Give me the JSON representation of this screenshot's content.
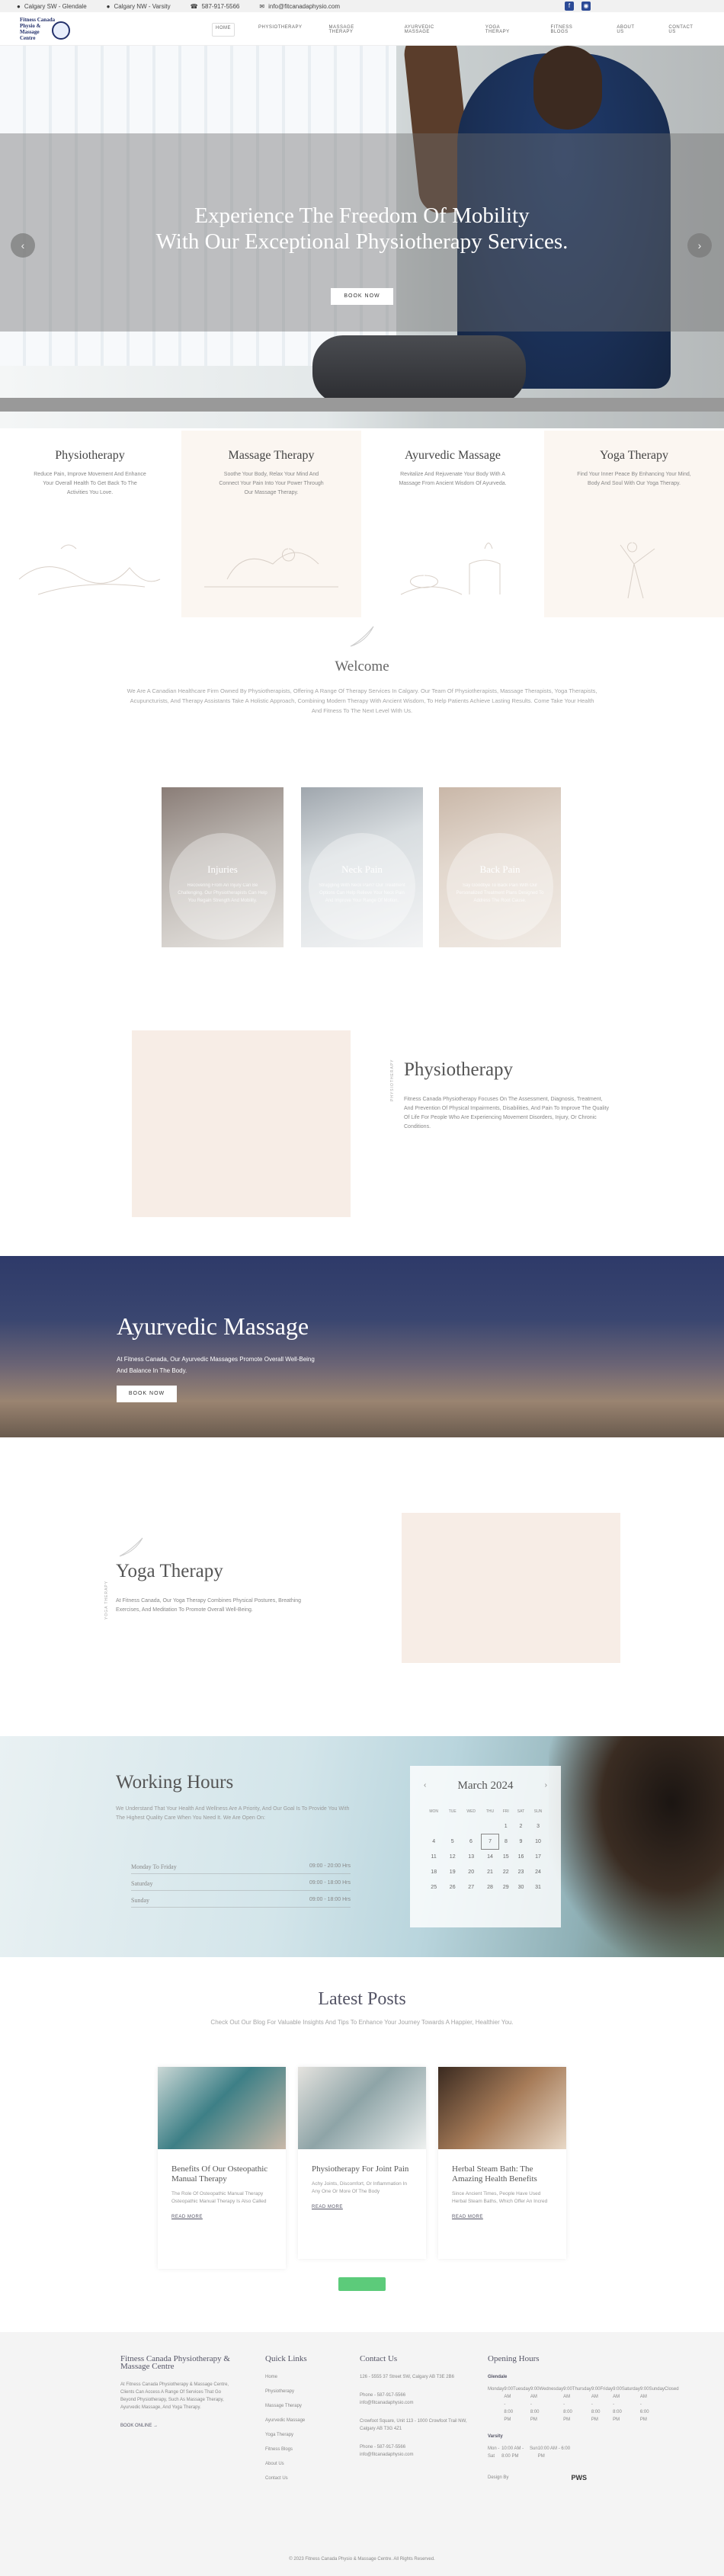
{
  "topbar": {
    "locations": [
      "Calgary SW - Glendale",
      "Calgary NW - Varsity"
    ],
    "phone": "587-917-5566",
    "email": "info@fitcanadaphysio.com"
  },
  "logo": {
    "line1": "Fitness Canada",
    "line2": "Physio &",
    "line3": "Massage",
    "line4": "Centre"
  },
  "menu": [
    "HOME",
    "PHYSIOTHERAPY",
    "MASSAGE THERAPY",
    "AYURVEDIC MASSAGE",
    "YOGA THERAPY",
    "FITNESS BLOGS",
    "ABOUT US",
    "CONTACT US"
  ],
  "hero": {
    "line1": "Experience The Freedom Of Mobility",
    "line2": "With Our Exceptional Physiotherapy Services.",
    "button": "BOOK NOW"
  },
  "services": [
    {
      "title": "Physiotherapy",
      "text": "Reduce Pain, Improve Movement And Enhance Your Overall Health To Get Back To The Activities You Love."
    },
    {
      "title": "Massage Therapy",
      "text": "Soothe Your Body, Relax Your Mind And Connect Your Pain Into Your Power Through Our Massage Therapy."
    },
    {
      "title": "Ayurvedic Massage",
      "text": "Revitalize And Rejuvenate Your Body With A Massage From Ancient Wisdom Of Ayurveda."
    },
    {
      "title": "Yoga Therapy",
      "text": "Find Your Inner Peace By Enhancing Your Mind, Body And Soul With Our Yoga Therapy."
    }
  ],
  "welcome": {
    "title": "Welcome",
    "text": "We Are A Canadian Healthcare Firm Owned By Physiotherapists, Offering A Range Of Therapy Services In Calgary. Our Team Of Physiotherapists, Massage Therapists, Yoga Therapists, Acupuncturists, And Therapy Assistants Take A Holistic Approach, Combining Modern Therapy With Ancient Wisdom, To Help Patients Achieve Lasting Results. Come Take Your Health And Fitness To The Next Level With Us."
  },
  "conditions": [
    {
      "title": "Injuries",
      "text": "Recovering From An Injury Can Be Challenging. Our Physiotherapists Can Help You Regain Strength And Mobility."
    },
    {
      "title": "Neck Pain",
      "text": "Struggling With Neck Pain? Our Treatment Options Can Help Relieve Your Neck Pain And Improve Your Range Of Motion."
    },
    {
      "title": "Back Pain",
      "text": "Say Goodbye To Back Pain With Our Personalized Treatment Plans Designed To Address The Root Cause."
    }
  ],
  "physio": {
    "label": "PHYSIOTHERAPY",
    "title": "Physiotherapy",
    "text": "Fitness Canada Physiotherapy Focuses On The Assessment, Diagnosis, Treatment, And Prevention Of Physical Impairments, Disabilities, And Pain To Improve The Quality Of Life For People Who Are Experiencing Movement Disorders, Injury, Or Chronic Conditions."
  },
  "ayurvedic": {
    "title": "Ayurvedic Massage",
    "text": "At Fitness Canada, Our Ayurvedic Massages Promote Overall Well-Being And Balance In The Body.",
    "button": "BOOK NOW"
  },
  "yoga": {
    "label": "YOGA THERAPY",
    "title": "Yoga Therapy",
    "text": "At Fitness Canada, Our Yoga Therapy Combines Physical Postures, Breathing Exercises, And Meditation To Promote Overall Well-Being."
  },
  "working_hours": {
    "title": "Working Hours",
    "text": "We Understand That Your Health And Wellness Are A Priority, And Our Goal Is To Provide You With The Highest Quality Care When You Need It. We Are Open On:",
    "rows": [
      {
        "day": "Monday To Friday",
        "time": "09:00 - 20:00 Hrs"
      },
      {
        "day": "Saturday",
        "time": "09:00 - 18:00 Hrs"
      },
      {
        "day": "Sunday",
        "time": "09:00 - 18:00 Hrs"
      }
    ]
  },
  "calendar": {
    "month": "March 2024",
    "days": [
      "MON",
      "TUE",
      "WED",
      "THU",
      "FRI",
      "SAT",
      "SUN"
    ],
    "weeks": [
      [
        "",
        "",
        "",
        "",
        "1",
        "2",
        "3"
      ],
      [
        "4",
        "5",
        "6",
        "7",
        "8",
        "9",
        "10"
      ],
      [
        "11",
        "12",
        "13",
        "14",
        "15",
        "16",
        "17"
      ],
      [
        "18",
        "19",
        "20",
        "21",
        "22",
        "23",
        "24"
      ],
      [
        "25",
        "26",
        "27",
        "28",
        "29",
        "30",
        "31"
      ]
    ],
    "today": "7"
  },
  "posts": {
    "title": "Latest Posts",
    "subtitle": "Check Out Our Blog For Valuable Insights And Tips To Enhance Your Journey Towards A Happier, Healthier You.",
    "items": [
      {
        "title": "Benefits Of Our Osteopathic Manual Therapy",
        "text": "The Role Of Osteopathic Manual Therapy Osteopathic Manual Therapy Is Also Called",
        "link": "READ MORE"
      },
      {
        "title": "Physiotherapy For Joint Pain",
        "text": "Achy Joints, Discomfort, Or Inflammation In Any One Or More Of The Body",
        "link": "READ MORE"
      },
      {
        "title": "Herbal Steam Bath: The Amazing Health Benefits",
        "text": "Since Ancient Times, People Have Used Herbal Steam Baths, Which Offer An Incred",
        "link": "READ MORE"
      }
    ]
  },
  "footer": {
    "about_title": "Fitness Canada Physiotherapy & Massage Centre",
    "about_text": "At Fitness Canada Physiotherapy & Massage Centre, Clients Can Access A Range Of Services That Go Beyond Physiotherapy, Such As Massage Therapy, Ayurvedic Massage, And Yoga Therapy.",
    "book": "BOOK ONLINE →",
    "quick_title": "Quick Links",
    "quick_links": [
      "Home",
      "Physiotherapy",
      "Massage Therapy",
      "Ayurvedic Massage",
      "Yoga Therapy",
      "Fitness Blogs",
      "About Us",
      "Contact Us"
    ],
    "contact_title": "Contact Us",
    "contact": [
      "126 - 5555 37 Street SW, Calgary AB T3E 2B6",
      "Phone - 587-917-5566",
      "info@fitcanadaphysio.com",
      "Crowfoot Square, Unit 113 - 1000 Crowfoot Trail NW, Calgary AB T3G 4Z1",
      "Phone - 587-917-5566",
      "info@fitcanadaphysio.com"
    ],
    "hours_title": "Opening Hours",
    "glendale": "Glendale",
    "glendale_hours": [
      [
        "Monday",
        "9:00 AM - 8:00 PM"
      ],
      [
        "Tuesday",
        "9:00 AM - 8:00 PM"
      ],
      [
        "Wednesday",
        "9:00 AM - 8:00 PM"
      ],
      [
        "Thursday",
        "9:00 AM - 8:00 PM"
      ],
      [
        "Friday",
        "9:00 AM - 8:00 PM"
      ],
      [
        "Saturday",
        "9:00 AM - 6:00 PM"
      ],
      [
        "Sunday",
        "Closed"
      ]
    ],
    "varsity": "Varsity",
    "varsity_hours": [
      [
        "Mon - Sat",
        "10:00 AM - 8:00 PM"
      ],
      [
        "Sun",
        "10:00 AM - 6:00 PM"
      ]
    ],
    "design": "Design By",
    "copyright": "© 2023 Fitness Canada Physio & Massage Centre. All Rights Reserved."
  }
}
